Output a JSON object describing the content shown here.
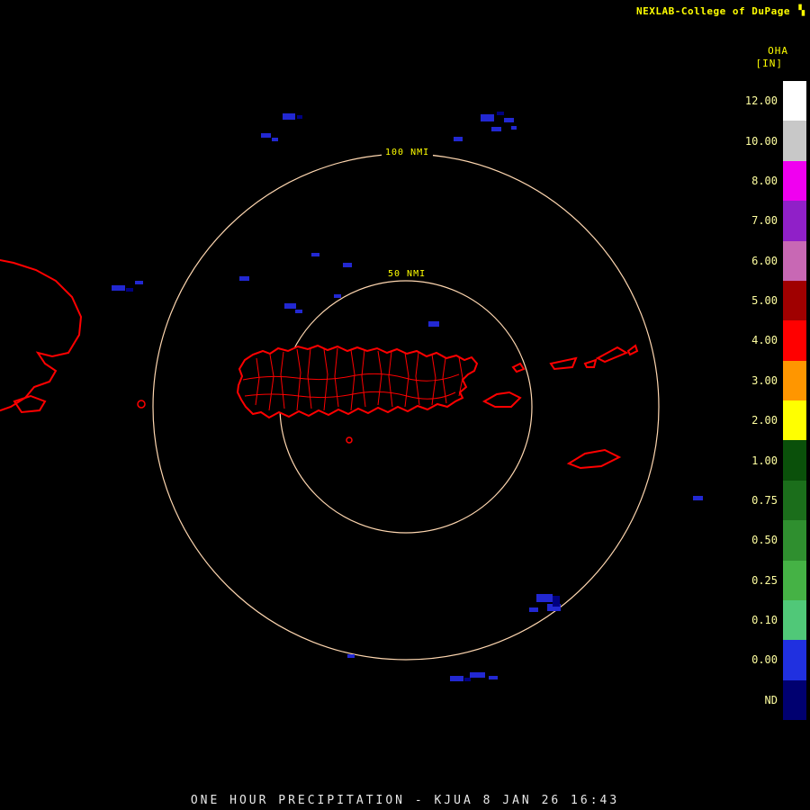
{
  "header": {
    "brand": "NEXLAB-College of DuPage",
    "logo_glyph": "▚",
    "product_code": "OHA",
    "units": "[IN]"
  },
  "rings": {
    "outer_label": "100 NMI",
    "inner_label": "50 NMI"
  },
  "colorbar": {
    "title": "OHA [IN]",
    "items": [
      {
        "label": "12.00",
        "color": "#ffffff"
      },
      {
        "label": "10.00",
        "color": "#c8c8c8"
      },
      {
        "label": "8.00",
        "color": "#f000f0"
      },
      {
        "label": "7.00",
        "color": "#9020c8"
      },
      {
        "label": "6.00",
        "color": "#c868b4"
      },
      {
        "label": "5.00",
        "color": "#a00000"
      },
      {
        "label": "4.00",
        "color": "#ff0000"
      },
      {
        "label": "3.00",
        "color": "#ff9600"
      },
      {
        "label": "2.00",
        "color": "#ffff00"
      },
      {
        "label": "1.00",
        "color": "#0a500a"
      },
      {
        "label": "0.75",
        "color": "#1b6e1b"
      },
      {
        "label": "0.50",
        "color": "#2f8f2f"
      },
      {
        "label": "0.25",
        "color": "#45b245"
      },
      {
        "label": "0.10",
        "color": "#50c878"
      },
      {
        "label": "0.00",
        "color": "#2030e0"
      },
      {
        "label": "ND",
        "color": "#000070"
      }
    ]
  },
  "map": {
    "ring_color": "#ffd7b0",
    "coast_color": "#ff0000",
    "echo_color": "#2228d2",
    "echo_color_dark": "#000080"
  },
  "footer": {
    "caption": "ONE HOUR PRECIPITATION - KJUA 8 JAN 26 16:43"
  }
}
